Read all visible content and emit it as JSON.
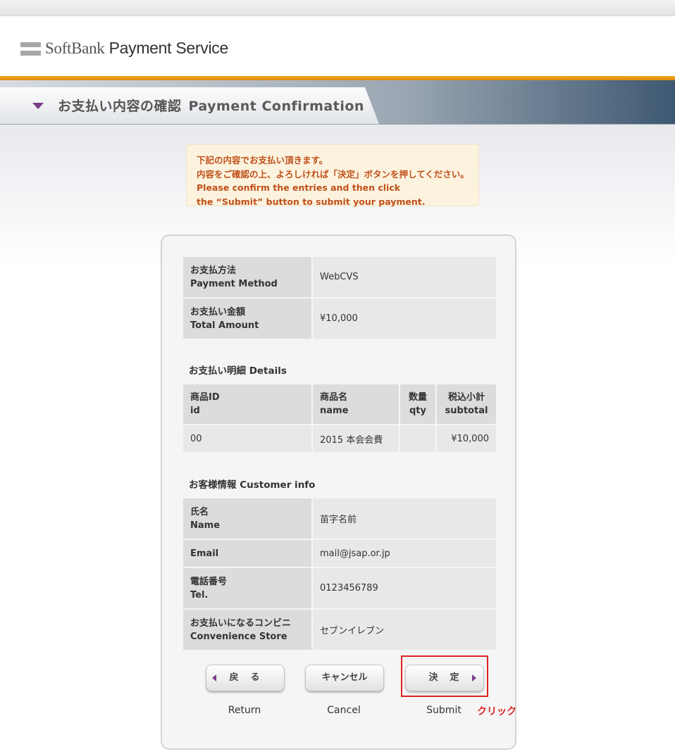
{
  "header": {
    "logo_main": "SoftBank",
    "logo_bold": "Payment Service"
  },
  "title": {
    "ja": "お支払い内容の確認",
    "en": "Payment Confirmation"
  },
  "notice": {
    "line1": "下記の内容でお支払い頂きます。",
    "line2": "内容をご確認の上、よろしければ「決定」ボタンを押してください。",
    "line3": "Please confirm the entries and then click",
    "line4": "the “Submit” button to submit your payment."
  },
  "payment": {
    "method_label_ja": "お支払方法",
    "method_label_en": "Payment Method",
    "method_value": "WebCVS",
    "amount_label_ja": "お支払い金額",
    "amount_label_en": "Total Amount",
    "amount_value": "¥10,000"
  },
  "details": {
    "title": "お支払い明細 Details",
    "columns": [
      {
        "ja": "商品ID",
        "en": "id"
      },
      {
        "ja": "商品名",
        "en": "name"
      },
      {
        "ja": "数量",
        "en": "qty"
      },
      {
        "ja": "税込小計",
        "en": "subtotal"
      }
    ],
    "rows": [
      {
        "id": "00",
        "name": "2015 本会会費",
        "qty": "",
        "subtotal": "¥10,000"
      }
    ]
  },
  "customer": {
    "title": "お客様情報 Customer info",
    "name_label_ja": "氏名",
    "name_label_en": "Name",
    "name_value": "苗字名前",
    "email_label": "Email",
    "email_value": "mail@jsap.or.jp",
    "tel_label_ja": "電話番号",
    "tel_label_en": "Tel.",
    "tel_value": "0123456789",
    "store_label_ja": "お支払いになるコンビニ",
    "store_label_en": "Convenience Store",
    "store_value": "セブンイレブン"
  },
  "buttons": {
    "back": "戻　る",
    "cancel": "キャンセル",
    "submit": "決　定",
    "back_caption": "Return",
    "cancel_caption": "Cancel",
    "submit_caption": "Submit"
  },
  "annotation": {
    "click_note": "クリック",
    "highlight_color": "#e02020"
  },
  "colors": {
    "accent_orange": "#f0a51a",
    "accent_purple": "#7a3a8a",
    "notice_text": "#c0501a"
  }
}
